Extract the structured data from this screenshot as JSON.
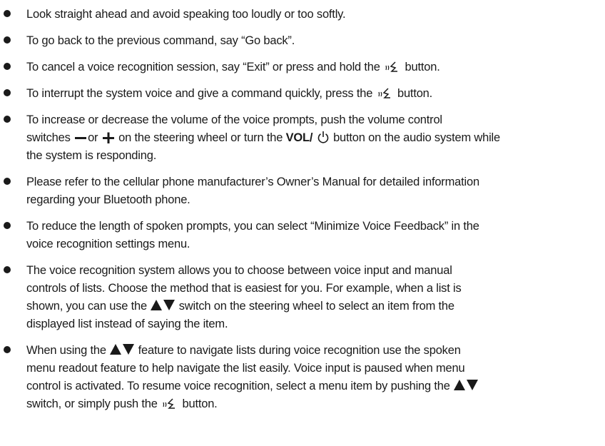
{
  "bullets": [
    {
      "t1": "Look straight ahead and avoid speaking too loudly or too softly."
    },
    {
      "t1": "To go back to the previous command, say “Go back”."
    },
    {
      "t1": "To cancel a voice recognition session, say “Exit” or press and hold the",
      "t2": "button."
    },
    {
      "t1": "To interrupt the system voice and give a command quickly, press the",
      "t2": "button."
    },
    {
      "l1": "To increase or decrease the volume of the voice prompts, push the volume control",
      "l2a": "switches",
      "l2b": "or",
      "l2c": "on the steering wheel or turn the",
      "l2bold": "VOL/",
      "l2d": "button on the audio system while",
      "l3": "the system is responding."
    },
    {
      "l1": "Please refer to the cellular phone manufacturer’s Owner’s Manual for detailed information",
      "l2": "regarding your Bluetooth phone."
    },
    {
      "l1": "To reduce the length of spoken prompts, you can select “Minimize Voice Feedback” in the",
      "l2": "voice recognition settings menu."
    },
    {
      "l1": "The voice recognition system allows you to choose between voice input and manual",
      "l2": "controls of lists. Choose the method that is easiest for you. For example, when a list is",
      "l3a": "shown, you can use the",
      "l3b": "switch on the steering wheel to select an item from the",
      "l4": "displayed list instead of saying the item."
    },
    {
      "l1a": "When using the",
      "l1b": "feature to navigate lists during voice recognition use the spoken",
      "l2": "menu readout feature to help navigate the list easily. Voice input is paused when menu",
      "l3": "control is activated. To resume voice recognition, select a menu item by pushing the",
      "l4a": "switch, or simply push the",
      "l4b": "button."
    }
  ],
  "icons": [
    "voice-talk-icon",
    "minus-icon",
    "plus-icon",
    "power-icon",
    "up-triangle-icon",
    "down-triangle-icon"
  ]
}
